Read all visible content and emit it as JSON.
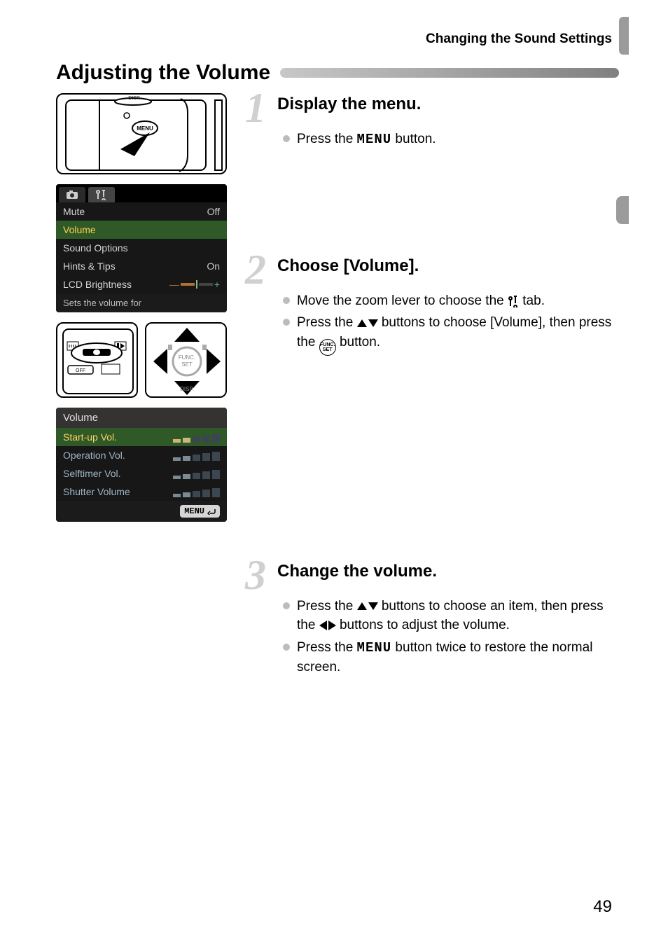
{
  "running_head": "Changing the Sound Settings",
  "section_title": "Adjusting the Volume",
  "page_number": "49",
  "menu_label": "MENU",
  "func_set_label_top": "FUNC.",
  "func_set_label_bottom": "SET",
  "steps": [
    {
      "num": "1",
      "title": "Display the menu.",
      "bullets": [
        {
          "pre": "Press the ",
          "mid": "MENU",
          "post": " button."
        }
      ]
    },
    {
      "num": "2",
      "title": "Choose [Volume].",
      "bullets": [
        {
          "pre": "Move the zoom lever to choose the ",
          "icon": "tools",
          "post": " tab."
        },
        {
          "pre": "Press the ",
          "icon": "updown",
          "post": " buttons to choose [Volume], then press the ",
          "icon2": "funcset",
          "post2": " button."
        }
      ]
    },
    {
      "num": "3",
      "title": "Change the volume.",
      "bullets": [
        {
          "pre": "Press the ",
          "icon": "updown",
          "post": " buttons to choose an item, then press the ",
          "icon2": "leftright",
          "post2": " buttons to adjust the volume."
        },
        {
          "pre": "Press the ",
          "mid": "MENU",
          "post": " button twice to restore the normal screen."
        }
      ]
    }
  ],
  "lcd1": {
    "rows": [
      {
        "label": "Mute",
        "value": "Off"
      },
      {
        "label": "Volume",
        "selected": true
      },
      {
        "label": "Sound Options"
      },
      {
        "label": "Hints & Tips",
        "value": "On"
      },
      {
        "label": "LCD Brightness",
        "slider": true
      }
    ],
    "footer": "Sets the volume for"
  },
  "lcd2": {
    "header": "Volume",
    "rows": [
      {
        "label": "Start-up Vol.",
        "selected": true,
        "level": 2
      },
      {
        "label": "Operation Vol.",
        "level": 2
      },
      {
        "label": "Selftimer Vol.",
        "level": 2
      },
      {
        "label": "Shutter Volume",
        "level": 2
      }
    ],
    "footer_badge": "MENU"
  }
}
